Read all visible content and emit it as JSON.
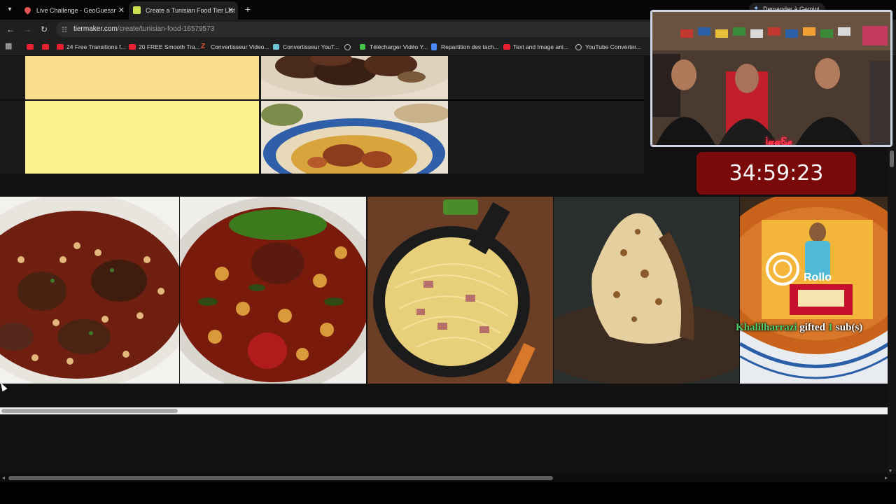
{
  "tabs": [
    {
      "title": "Live Challenge - GeoGuessr",
      "active": false
    },
    {
      "title": "Create a Tunisian Food Tier List",
      "active": true
    }
  ],
  "toolbar": {
    "url_host": "tiermaker.com",
    "url_path": "/create/tunisian-food-16579573",
    "gemini_label": "Demander à Gemini"
  },
  "bookmarks": [
    {
      "label": "",
      "icon": "youtube-icon"
    },
    {
      "label": "",
      "icon": "youtube-icon"
    },
    {
      "label": "24 Free Transitions f...",
      "icon": "youtube-icon"
    },
    {
      "label": "20 FREE Smooth Tra...",
      "icon": "youtube-icon"
    },
    {
      "label": "Convertisseur Video...",
      "icon": "z-icon"
    },
    {
      "label": "Convertisseur YouT...",
      "icon": "converter-icon"
    },
    {
      "label": "",
      "icon": "globe-icon"
    },
    {
      "label": "Télécharger Vidéo Y...",
      "icon": "download-icon"
    },
    {
      "label": "Repartition des tach...",
      "icon": "doc-icon"
    },
    {
      "label": "Text and Image ani...",
      "icon": "youtube-icon"
    },
    {
      "label": "YouTube Converter...",
      "icon": "globe-icon"
    }
  ],
  "tiers": [
    {
      "color": "#f9dd8c"
    },
    {
      "color": "#fdf18c"
    }
  ],
  "food_items": [
    {
      "name": "bean-meat-stew"
    },
    {
      "name": "chickpea-spinach-stew"
    },
    {
      "name": "spaghetti-skillet"
    },
    {
      "name": "stuffed-bread"
    },
    {
      "name": "soup-bowl"
    }
  ],
  "stream": {
    "timer": "34:59:23",
    "cam_name": "Ꭵ𝓾𝓾Ꮛ𝓮",
    "promo_label": "Rollo",
    "gift_user": "Khalilharrazi",
    "gift_mid": "gifted",
    "gift_count": "1",
    "gift_tail": "sub(s)"
  },
  "colors": {
    "tier_a": "#f9dd8c",
    "tier_b": "#fdf18c",
    "timer_bg": "#7a0a0a",
    "gift_green": "#4fd06a"
  }
}
